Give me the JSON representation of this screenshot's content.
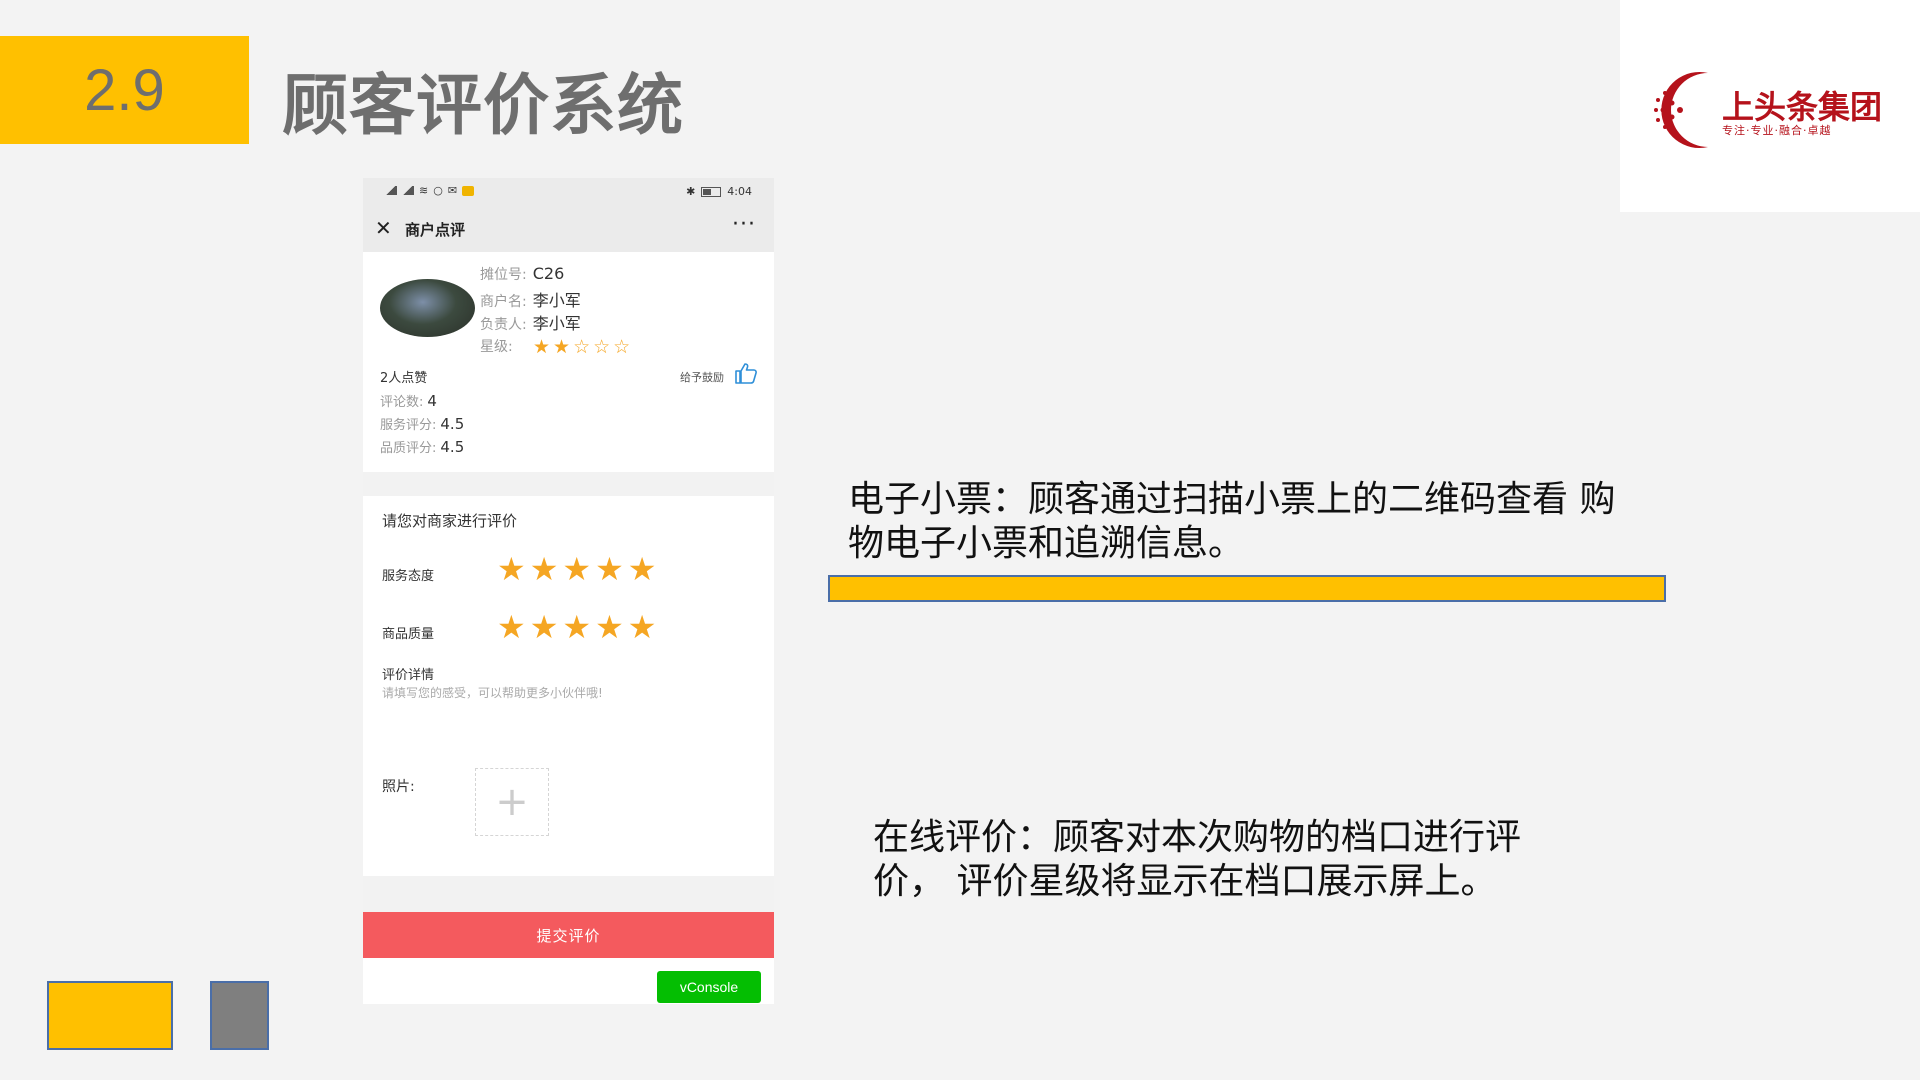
{
  "header": {
    "section_number": "2.9",
    "title": "顾客评价系统"
  },
  "logo": {
    "name": "上头条集团",
    "slogan": "专注·专业·融合·卓越",
    "brand_color": "#b5121b"
  },
  "phone": {
    "status_bar": {
      "time": "4:04"
    },
    "nav": {
      "close_icon": "close-icon",
      "title": "商户点评",
      "more": "···"
    },
    "merchant": {
      "stall_label": "摊位号:",
      "stall_value": "C26",
      "name_label": "商户名:",
      "name_value": "李小军",
      "owner_label": "负责人:",
      "owner_value": "李小军",
      "rating_label": "星级:",
      "rating_stars": "★★☆☆☆",
      "rating_value": 2,
      "rating_max": 5,
      "likes": "2人点赞",
      "encourage": "给予鼓励",
      "comment_count_label": "评论数:",
      "comment_count_value": "4",
      "service_score_label": "服务评分:",
      "service_score_value": "4.5",
      "quality_score_label": "品质评分:",
      "quality_score_value": "4.5"
    },
    "review": {
      "prompt": "请您对商家进行评价",
      "service_label": "服务态度",
      "service_stars": "★★★★★",
      "service_rating": 5,
      "quality_label": "商品质量",
      "quality_stars": "★★★★★",
      "quality_rating": 5,
      "detail_label": "评价详情",
      "detail_placeholder": "请填写您的感受，可以帮助更多小伙伴哦!",
      "photo_label": "照片:",
      "photo_add": "+"
    },
    "submit_label": "提交评价",
    "vconsole_label": "vConsole"
  },
  "notes": {
    "receipt": "电子小票：顾客通过扫描小票上的二维码查看 购物电子小票和追溯信息。",
    "online": "在线评价：顾客对本次购物的档口进行评价， 评价星级将显示在档口展示屏上。"
  },
  "colors": {
    "accent_yellow": "#ffc000",
    "title_gray": "#6e6e6e",
    "submit_red": "#f45a5e",
    "star_orange": "#f5a623",
    "vconsole_green": "#04be02"
  }
}
